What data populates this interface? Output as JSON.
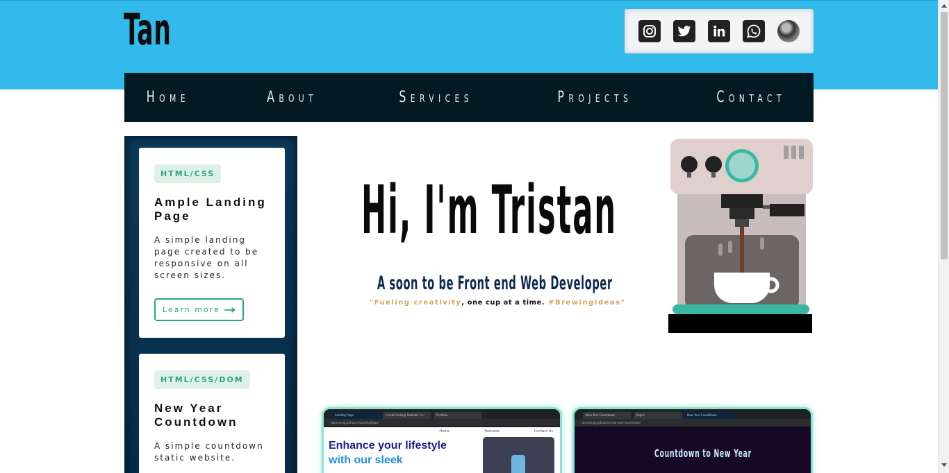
{
  "header": {
    "logo": "Tan",
    "social": [
      {
        "name": "instagram",
        "icon": "instagram-icon"
      },
      {
        "name": "twitter",
        "icon": "twitter-icon"
      },
      {
        "name": "linkedin",
        "icon": "linkedin-icon"
      },
      {
        "name": "whatsapp",
        "icon": "whatsapp-icon"
      },
      {
        "name": "profile",
        "icon": "avatar"
      }
    ]
  },
  "nav": {
    "items": [
      "Home",
      "About",
      "Services",
      "Projects",
      "Contact"
    ]
  },
  "projects": [
    {
      "tag": "HTML/CSS",
      "title": "Ample Landing Page",
      "description": "A simple landing page created to be responsive on all screen sizes.",
      "cta": "Learn more"
    },
    {
      "tag": "HTML/CSS/DOM",
      "title": "New Year Countdown",
      "description": "A simple countdown static website."
    }
  ],
  "hero": {
    "title": "Hi, I'm Tristan",
    "subtitle": "A soon to be Front end Web Developer",
    "tagline_quote": "\"Fueling creativity",
    "tagline_mid": ", one cup at a time.",
    "tagline_hashtag": "#BrewingIdeas\""
  },
  "thumbnails": [
    {
      "tabs": [
        "Landing Page",
        "(Great Coding) Realistic Co...",
        "Portfolio"
      ],
      "url": "tbyronengj.github.io/LandingPage/",
      "nav": [
        "Home",
        "Features",
        "Contact Us"
      ],
      "headline_line1": "Enhance your lifestyle",
      "headline_line2": "with our sleek"
    },
    {
      "tabs": [
        "New Year Countdown",
        "Pages",
        "New Year CountDown"
      ],
      "url": "tbyronengj.github.io/new-year-countdown/",
      "headline": "Countdown to New Year"
    }
  ],
  "colors": {
    "header_band": "#31baea",
    "nav_bg": "#031a22",
    "sidebar_bg": "#0b3a5c",
    "accent_teal": "#2aa38a",
    "tagline_gold": "#d4a561"
  }
}
